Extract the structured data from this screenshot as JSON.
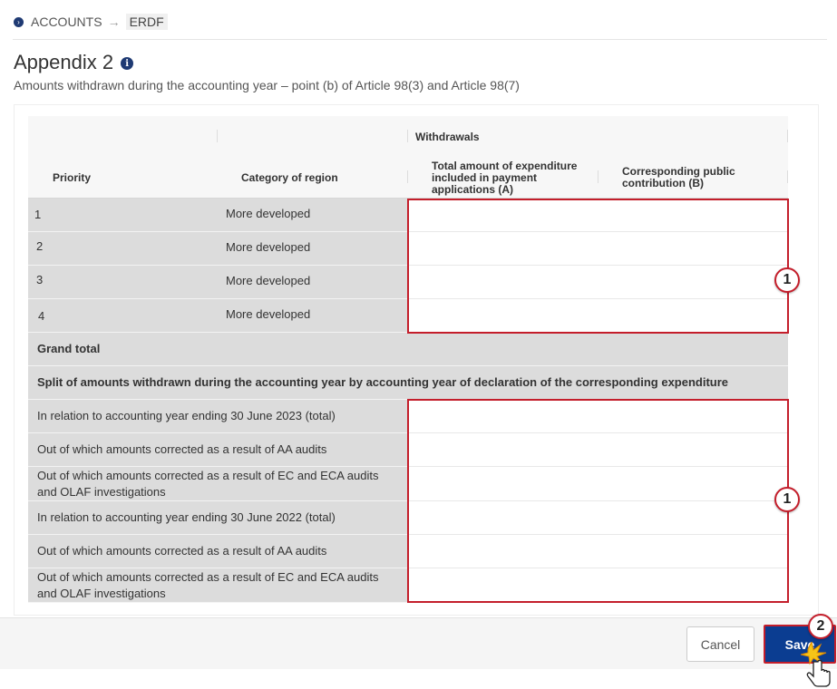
{
  "breadcrumb": {
    "items": [
      "ACCOUNTS",
      "ERDF"
    ],
    "separator": "→"
  },
  "page": {
    "title": "Appendix 2",
    "subtitle": "Amounts withdrawn during the accounting year – point (b) of Article 98(3) and Article 98(7)"
  },
  "table": {
    "group_header": "Withdrawals",
    "columns": {
      "priority": "Priority",
      "category": "Category of region",
      "col_a": "Total amount of expenditure included in payment applications (A)",
      "col_b": "Corresponding public contribution (B)"
    },
    "rows": [
      {
        "priority": "1",
        "category": "More developed"
      },
      {
        "priority": "2",
        "category": "More developed"
      },
      {
        "priority": "3",
        "category": "More developed"
      },
      {
        "priority": "4",
        "category": "More developed"
      }
    ],
    "grand_total": "Grand total",
    "split_header": "Split of amounts withdrawn during the accounting year by accounting year of declaration of the corresponding expenditure",
    "split_rows": [
      "In relation to accounting year ending 30 June 2023 (total)",
      "Out of which amounts corrected as a result of AA audits",
      "Out of which amounts corrected as a result of EC and ECA audits and OLAF investigations",
      "In relation to accounting year ending 30 June 2022 (total)",
      "Out of which amounts corrected as a result of AA audits",
      "Out of which amounts corrected as a result of EC and ECA audits and OLAF investigations"
    ]
  },
  "annotations": {
    "callout_1": "1",
    "callout_2": "2"
  },
  "footer": {
    "cancel_label": "Cancel",
    "save_label": "Save"
  },
  "colors": {
    "primary": "#0b3d91",
    "highlight": "#c41e2b",
    "label_bg": "#dcdcdc"
  }
}
